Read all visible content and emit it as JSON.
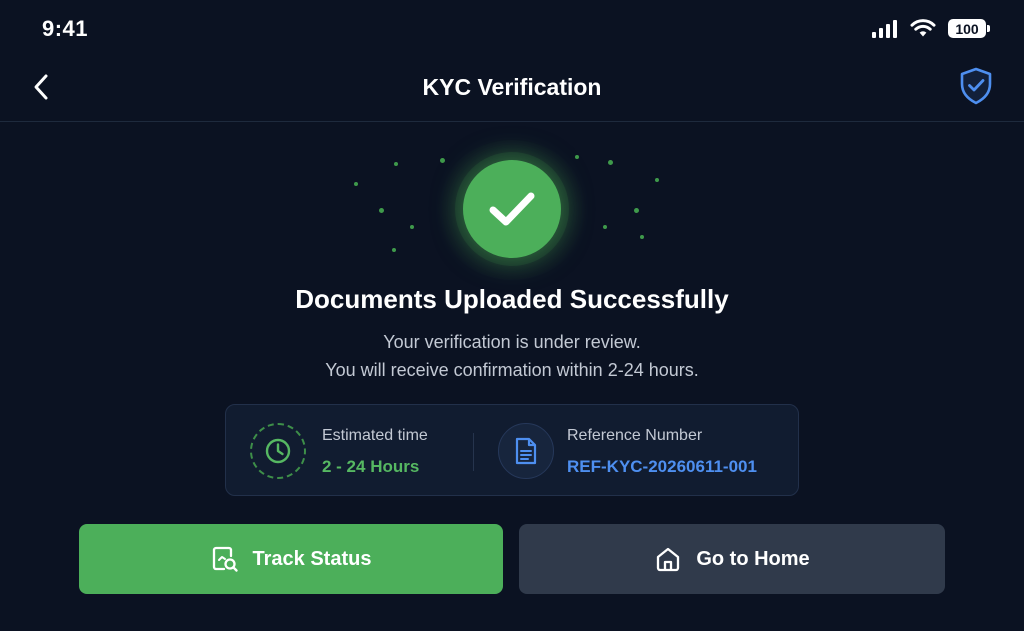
{
  "status_bar": {
    "time": "9:41",
    "battery": "100",
    "icons": [
      "signal-icon",
      "wifi-icon",
      "battery-icon"
    ]
  },
  "nav": {
    "title": "KYC Verification",
    "back_icon": "chevron-left-icon",
    "right_icon": "shield-check-icon"
  },
  "success": {
    "icon": "checkmark-icon",
    "title": "Documents Uploaded Successfully",
    "line1": "Your verification is under review.",
    "line2": "You will receive confirmation within 2-24 hours."
  },
  "info": {
    "estimated_label": "Estimated time",
    "estimated_value": "2 - 24 Hours",
    "reference_label": "Reference Number",
    "reference_value": "REF-KYC-20260611-001"
  },
  "actions": {
    "track_label": "Track Status",
    "home_label": "Go to Home"
  },
  "colors": {
    "background": "#0b1222",
    "success_green": "#4caf5a",
    "link_blue": "#4e8ff0",
    "secondary_button": "#303a4b"
  }
}
